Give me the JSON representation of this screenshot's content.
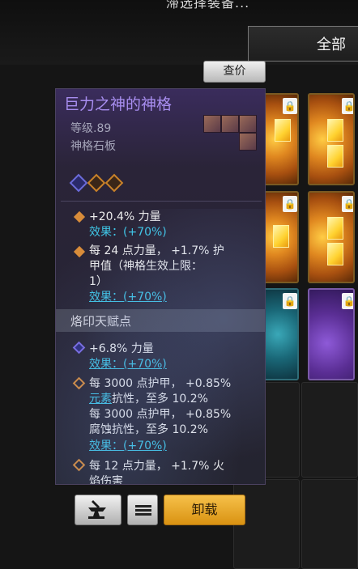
{
  "header": {
    "partial_text": "滞选择装备...",
    "filter_label": "全部"
  },
  "price_button": "查价",
  "tooltip": {
    "title": "巨力之神的神格",
    "level": "等级.89",
    "type": "神格石板",
    "stats": [
      {
        "text": "+20.4% 力量",
        "effect": "效果：(+70%)"
      },
      {
        "text_lines": [
          "每 24 点力量， +1.7% 护",
          "甲值（神格生效上限：",
          "1）"
        ],
        "effect": "效果：(+70%)"
      }
    ],
    "section_title": "烙印天赋点",
    "talents": [
      {
        "text": "+6.8% 力量",
        "effect": "效果：(+70%)"
      },
      {
        "text_lines": [
          "每 3000 点护甲， +0.85%",
          "抗性，至多 10.2%",
          "每 3000 点护甲， +0.85%",
          "腐蚀抗性，至多 10.2%"
        ],
        "link": "元素",
        "effect": "效果：(+70%)"
      },
      {
        "text_lines": [
          "每 12 点力量， +1.7% 火",
          "焰伤害"
        ]
      }
    ]
  },
  "buttons": {
    "menu": "≡",
    "unequip": "卸载"
  },
  "colors": {
    "title": "#a88ef0",
    "effect": "#3fc6e6",
    "unequip_bg": "#f0b030",
    "tooltip_bg": "#2a2438"
  }
}
